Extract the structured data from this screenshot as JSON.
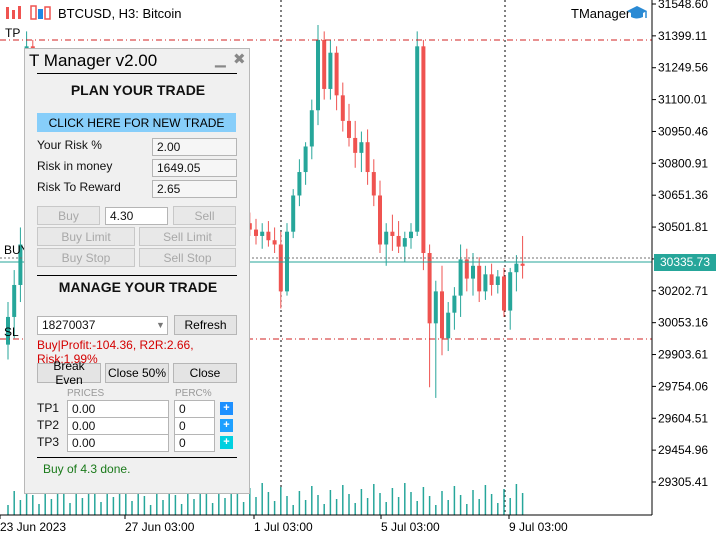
{
  "header": {
    "symbol": "BTCUSD, H3:  Bitcoin",
    "indicator": "TManager"
  },
  "chart_tags": {
    "tp": "TP",
    "buy": "BUY",
    "sl": "SL"
  },
  "chart_data": {
    "type": "candlestick",
    "price_ticks": [
      "31548.60",
      "31399.11",
      "31249.56",
      "31100.01",
      "30950.46",
      "30800.91",
      "30651.36",
      "30501.81",
      "30352.26",
      "30202.71",
      "30053.16",
      "29903.61",
      "29754.06",
      "29604.51",
      "29454.96",
      "29305.41"
    ],
    "time_ticks": [
      "23 Jun 2023",
      "27 Jun 03:00",
      "1 Jul 03:00",
      "5 Jul 03:00",
      "9 Jul 03:00"
    ],
    "current_price": "30335.73",
    "candles": [
      [
        29950,
        30150,
        29880,
        30080
      ],
      [
        30080,
        30300,
        29980,
        30230
      ],
      [
        30230,
        30500,
        30150,
        30420
      ],
      [
        30420,
        31420,
        30350,
        31350
      ],
      [
        31350,
        31380,
        30900,
        30950
      ],
      [
        30950,
        31050,
        30820,
        30880
      ],
      [
        30880,
        30950,
        30700,
        30780
      ],
      [
        30780,
        30850,
        30580,
        30650
      ],
      [
        30650,
        30720,
        30480,
        30560
      ],
      [
        30560,
        30650,
        30420,
        30600
      ],
      [
        30600,
        30660,
        30450,
        30520
      ],
      [
        30520,
        30600,
        30380,
        30430
      ],
      [
        30430,
        30500,
        30320,
        30380
      ],
      [
        30380,
        30460,
        30300,
        30420
      ],
      [
        30420,
        30480,
        30330,
        30360
      ],
      [
        30360,
        30420,
        30280,
        30300
      ],
      [
        30300,
        30390,
        30250,
        30340
      ],
      [
        30340,
        30400,
        30270,
        30290
      ],
      [
        30290,
        30360,
        30230,
        30320
      ],
      [
        30320,
        30380,
        30260,
        30350
      ],
      [
        30350,
        30420,
        30300,
        30380
      ],
      [
        30380,
        30440,
        30320,
        30360
      ],
      [
        30360,
        30400,
        30290,
        30330
      ],
      [
        30330,
        30400,
        30300,
        30370
      ],
      [
        30370,
        30430,
        30330,
        30400
      ],
      [
        30400,
        30460,
        30350,
        30380
      ],
      [
        30380,
        30450,
        30330,
        30420
      ],
      [
        30420,
        30490,
        30370,
        30450
      ],
      [
        30450,
        30510,
        30390,
        30470
      ],
      [
        30470,
        30520,
        30400,
        30440
      ],
      [
        30440,
        30500,
        30380,
        30420
      ],
      [
        30420,
        30480,
        30360,
        30460
      ],
      [
        30460,
        30520,
        30410,
        30490
      ],
      [
        30490,
        30560,
        30440,
        30520
      ],
      [
        30520,
        30580,
        30470,
        30540
      ],
      [
        30540,
        30600,
        30480,
        30510
      ],
      [
        30510,
        30570,
        30450,
        30530
      ],
      [
        30530,
        30590,
        30470,
        30560
      ],
      [
        30560,
        30610,
        30500,
        30520
      ],
      [
        30520,
        30570,
        30460,
        30490
      ],
      [
        30490,
        30540,
        30420,
        30460
      ],
      [
        30460,
        30520,
        30400,
        30480
      ],
      [
        30480,
        30530,
        30410,
        30440
      ],
      [
        30440,
        30500,
        30380,
        30420
      ],
      [
        30420,
        30480,
        30120,
        30200
      ],
      [
        30200,
        30520,
        30180,
        30480
      ],
      [
        30480,
        30680,
        30450,
        30650
      ],
      [
        30650,
        30820,
        30600,
        30760
      ],
      [
        30760,
        30900,
        30700,
        30880
      ],
      [
        30880,
        31100,
        30820,
        31050
      ],
      [
        31050,
        31450,
        30980,
        31380
      ],
      [
        31380,
        31420,
        31100,
        31150
      ],
      [
        31150,
        31380,
        31100,
        31320
      ],
      [
        31320,
        31350,
        31050,
        31120
      ],
      [
        31120,
        31180,
        30950,
        31000
      ],
      [
        31000,
        31080,
        30880,
        30920
      ],
      [
        30920,
        31000,
        30780,
        30850
      ],
      [
        30850,
        30950,
        30760,
        30900
      ],
      [
        30900,
        30960,
        30700,
        30760
      ],
      [
        30760,
        30820,
        30600,
        30650
      ],
      [
        30650,
        30720,
        30380,
        30420
      ],
      [
        30420,
        30520,
        30320,
        30480
      ],
      [
        30480,
        30560,
        30390,
        30460
      ],
      [
        30460,
        30530,
        30380,
        30410
      ],
      [
        30410,
        30480,
        30340,
        30450
      ],
      [
        30450,
        30520,
        30400,
        30480
      ],
      [
        30480,
        31420,
        30460,
        31350
      ],
      [
        31350,
        31380,
        30300,
        30380
      ],
      [
        30380,
        30420,
        29750,
        30050
      ],
      [
        30050,
        30250,
        29700,
        30200
      ],
      [
        30200,
        30320,
        29900,
        29980
      ],
      [
        29980,
        30150,
        29920,
        30100
      ],
      [
        30100,
        30220,
        30020,
        30180
      ],
      [
        30180,
        30420,
        30080,
        30350
      ],
      [
        30350,
        30400,
        30200,
        30260
      ],
      [
        30260,
        30380,
        30180,
        30320
      ],
      [
        30320,
        30360,
        30150,
        30200
      ],
      [
        30200,
        30320,
        30160,
        30280
      ],
      [
        30280,
        30330,
        30180,
        30230
      ],
      [
        30230,
        30300,
        30190,
        30270
      ],
      [
        30270,
        30310,
        30080,
        30110
      ],
      [
        30110,
        30310,
        30020,
        30290
      ],
      [
        30290,
        30370,
        30200,
        30330
      ],
      [
        30330,
        30460,
        30260,
        30320
      ]
    ]
  },
  "panel": {
    "title": "T Manager v2.00",
    "plan_heading": "PLAN YOUR TRADE",
    "new_trade_label": "CLICK HERE FOR NEW TRADE",
    "risk_pct_label": "Your Risk %",
    "risk_pct_value": "2.00",
    "risk_money_label": "Risk in money",
    "risk_money_value": "1649.05",
    "rr_label": "Risk To Reward",
    "rr_value": "2.65",
    "buy_label": "Buy",
    "lot_value": "4.30",
    "sell_label": "Sell",
    "buy_limit_label": "Buy Limit",
    "sell_limit_label": "Sell Limit",
    "buy_stop_label": "Buy Stop",
    "sell_stop_label": "Sell Stop",
    "manage_heading": "MANAGE YOUR TRADE",
    "ticket_value": "18270037",
    "refresh_label": "Refresh",
    "status_line": "Buy|Profit:-104.36, R2R:2.66, Risk:1.99%",
    "break_even_label": "Break Even",
    "close50_label": "Close 50%",
    "close_label": "Close",
    "prices_header": "PRICES",
    "perc_header": "PERC%",
    "tps": [
      {
        "label": "TP1",
        "price": "0.00",
        "perc": "0"
      },
      {
        "label": "TP2",
        "price": "0.00",
        "perc": "0"
      },
      {
        "label": "TP3",
        "price": "0.00",
        "perc": "0"
      }
    ],
    "plus_symbol": "+",
    "footer_message": "Buy of 4.3 done."
  },
  "colors": {
    "bull": "#26a69a",
    "bear": "#ef5350",
    "tp_line": "#d02020",
    "price_line": "#26a69a",
    "tp1_btn": "#1e90ff",
    "tp2_btn": "#1ea0ff",
    "tp3_btn": "#00d0e0"
  }
}
